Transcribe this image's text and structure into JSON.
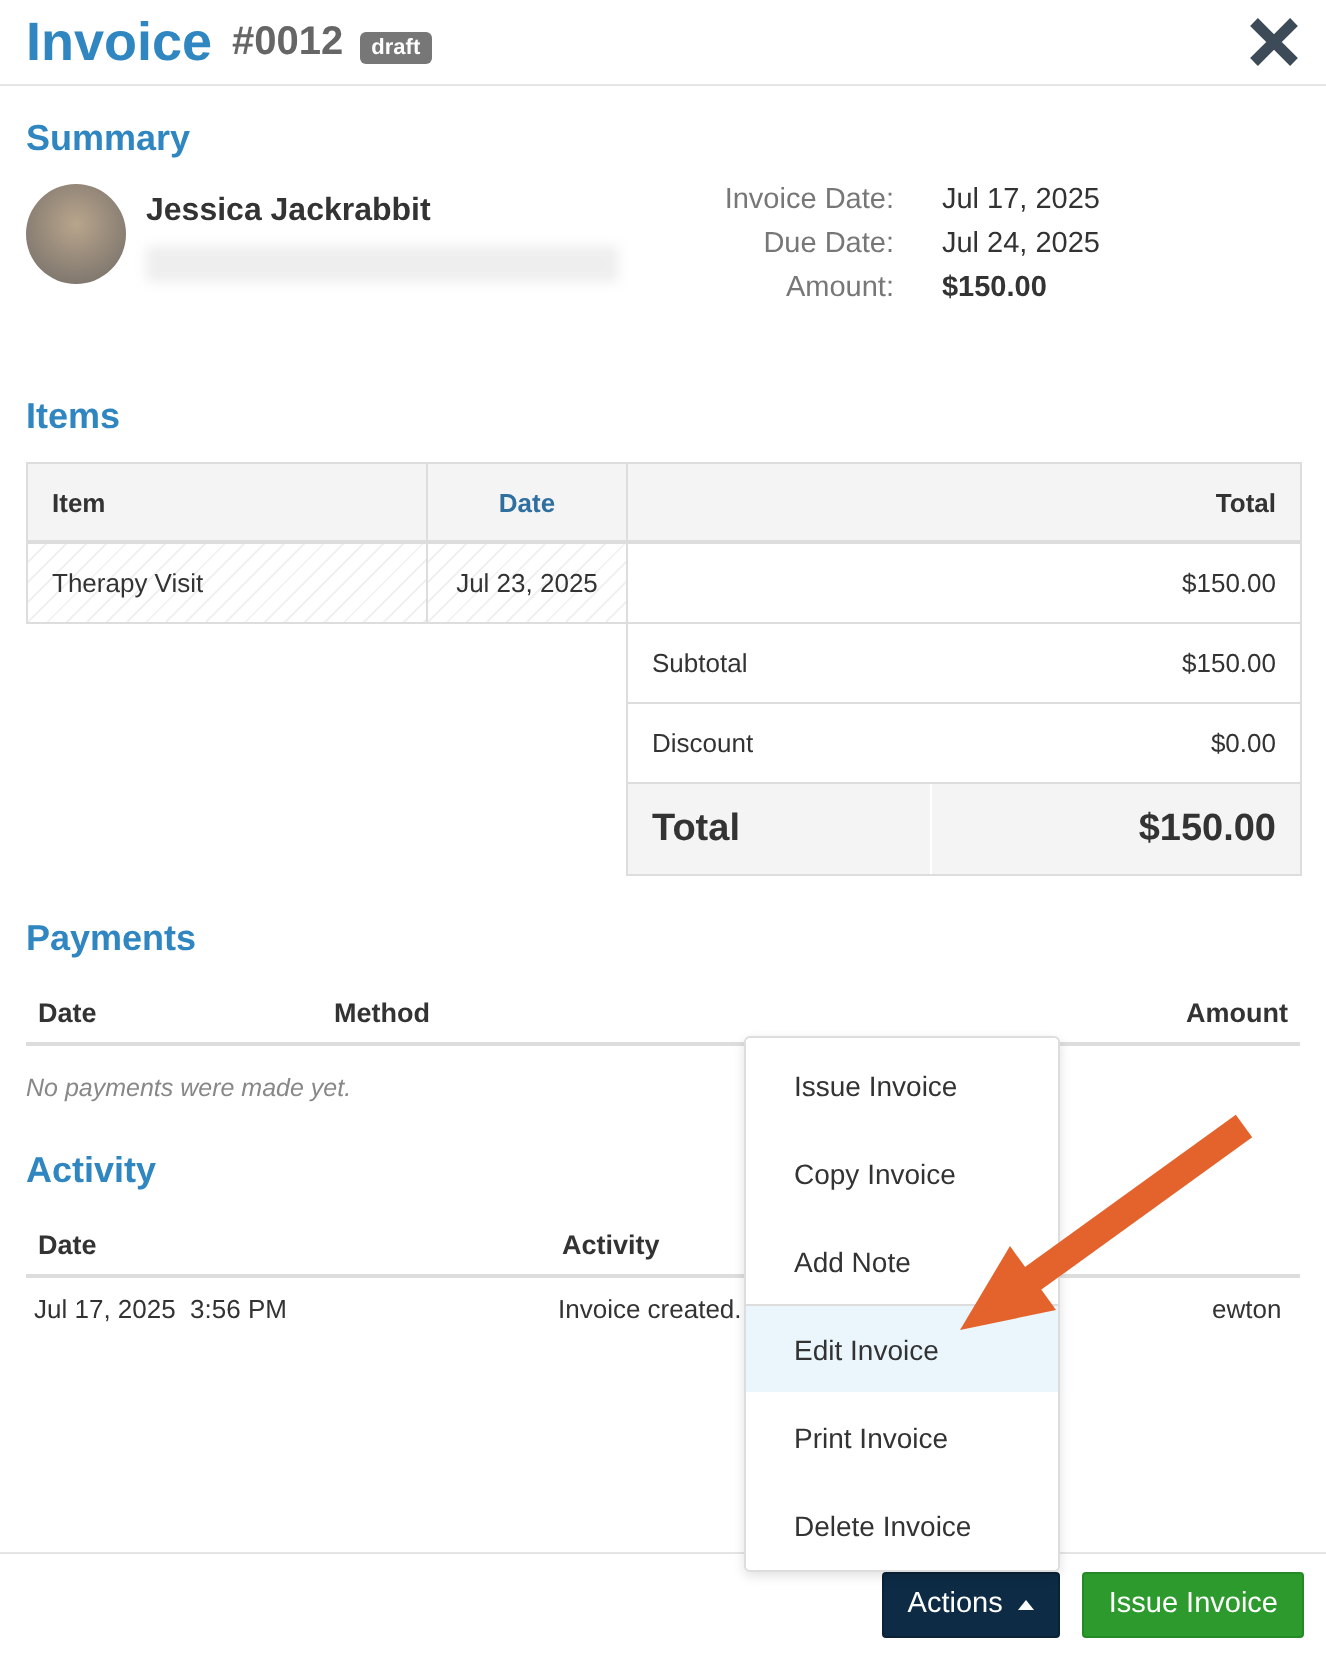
{
  "header": {
    "title": "Invoice",
    "number": "#0012",
    "badge": "draft"
  },
  "summary": {
    "heading": "Summary",
    "customer": {
      "name": "Jessica Jackrabbit"
    },
    "details": [
      {
        "label": "Invoice Date:",
        "value": "Jul 17, 2025",
        "kind": "plain"
      },
      {
        "label": "Due Date:",
        "value": "Jul 24, 2025",
        "kind": "plain"
      },
      {
        "label": "Amount:",
        "value": "$150.00",
        "kind": "strong"
      }
    ]
  },
  "items": {
    "heading": "Items",
    "columns": [
      {
        "label": "Item",
        "sorted": false
      },
      {
        "label": "Date",
        "sorted": true
      },
      {
        "label": "Total",
        "sorted": false
      }
    ],
    "rows": [
      {
        "item": "Therapy Visit",
        "date": "Jul 23, 2025",
        "total": "$150.00"
      }
    ],
    "totals": [
      {
        "label": "Subtotal",
        "value": "$150.00",
        "kind": "line"
      },
      {
        "label": "Discount",
        "value": "$0.00",
        "kind": "line"
      },
      {
        "label": "Total",
        "value": "$150.00",
        "kind": "grand"
      }
    ]
  },
  "payments": {
    "heading": "Payments",
    "columns": [
      "Date",
      "Method",
      "Amount"
    ],
    "empty": "No payments were made yet."
  },
  "activity": {
    "heading": "Activity",
    "columns": [
      "Date",
      "Activity"
    ],
    "rows": [
      {
        "date": "Jul 17, 2025  3:56 PM",
        "activity": "Invoice created.",
        "column_3": "ewton"
      }
    ]
  },
  "actions_menu": {
    "items": [
      {
        "label": "Issue Invoice",
        "selected": false
      },
      {
        "label": "Copy Invoice",
        "selected": false
      },
      {
        "label": "Add Note",
        "selected": false
      },
      {
        "label": "Edit Invoice",
        "selected": true
      },
      {
        "label": "Print Invoice",
        "selected": false
      },
      {
        "label": "Delete Invoice",
        "selected": false
      }
    ]
  },
  "footer": {
    "buttons": [
      {
        "label": "Actions",
        "kind": "dropdown"
      },
      {
        "label": "Issue Invoice",
        "kind": "primary"
      }
    ]
  }
}
